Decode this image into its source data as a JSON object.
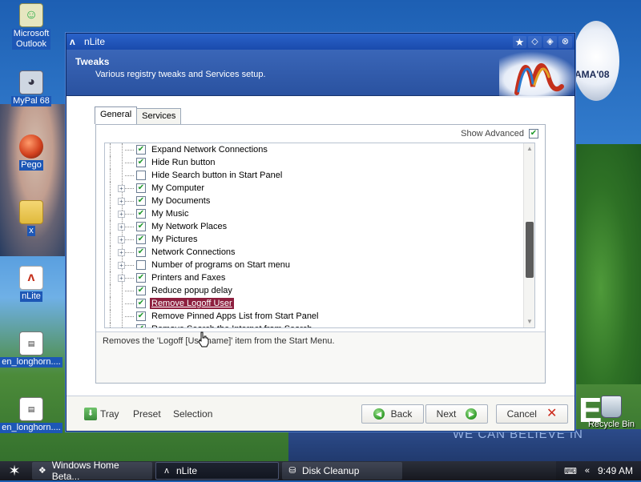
{
  "desktop": {
    "icons": [
      {
        "label_lines": [
          "Microsoft",
          "Outlook"
        ]
      },
      {
        "label_lines": [
          "MyPal 68"
        ]
      },
      {
        "label_lines": [
          "Pego"
        ]
      },
      {
        "label_lines": [
          "x"
        ]
      },
      {
        "label_lines": [
          "nLite"
        ]
      },
      {
        "label_lines": [
          "en_longhorn...."
        ]
      },
      {
        "label_lines": [
          "en_longhorn...."
        ]
      }
    ],
    "recycle_bin_label": "Recycle Bin",
    "wallpaper_text": {
      "campaign": "AMA'08",
      "slogan": "WE CAN BELIEVE IN",
      "letter": "E"
    }
  },
  "window": {
    "title": "nLite",
    "title_buttons": [
      "star",
      "restore",
      "minimize",
      "close"
    ],
    "header": {
      "title": "Tweaks",
      "subtitle": "Various registry tweaks and Services setup."
    },
    "tabs": [
      {
        "label": "General",
        "active": true
      },
      {
        "label": "Services",
        "active": false
      }
    ],
    "show_advanced": {
      "label": "Show Advanced",
      "checked": true
    },
    "tree_items": [
      {
        "label": "Expand Network Connections",
        "checked": true,
        "expander": false,
        "selected": false
      },
      {
        "label": "Hide Run button",
        "checked": true,
        "expander": false,
        "selected": false
      },
      {
        "label": "Hide Search button in Start Panel",
        "checked": false,
        "expander": false,
        "selected": false
      },
      {
        "label": "My Computer",
        "checked": true,
        "expander": true,
        "selected": false
      },
      {
        "label": "My Documents",
        "checked": true,
        "expander": true,
        "selected": false
      },
      {
        "label": "My Music",
        "checked": true,
        "expander": true,
        "selected": false
      },
      {
        "label": "My Network Places",
        "checked": true,
        "expander": true,
        "selected": false
      },
      {
        "label": "My Pictures",
        "checked": true,
        "expander": true,
        "selected": false
      },
      {
        "label": "Network Connections",
        "checked": true,
        "expander": true,
        "selected": false
      },
      {
        "label": "Number of programs on Start menu",
        "checked": false,
        "expander": true,
        "selected": false
      },
      {
        "label": "Printers and Faxes",
        "checked": true,
        "expander": true,
        "selected": false
      },
      {
        "label": "Reduce popup delay",
        "checked": true,
        "expander": false,
        "selected": false
      },
      {
        "label": "Remove Logoff User",
        "checked": true,
        "expander": false,
        "selected": true
      },
      {
        "label": "Remove Pinned Apps List from Start Panel",
        "checked": true,
        "expander": false,
        "selected": false
      },
      {
        "label": "Remove Search the Internet from Search",
        "checked": true,
        "expander": false,
        "selected": false
      }
    ],
    "description": "Removes the 'Logoff [Username]' item from the Start Menu.",
    "footer": {
      "tray": "Tray",
      "preset": "Preset",
      "selection": "Selection",
      "back": "Back",
      "next": "Next",
      "cancel": "Cancel"
    }
  },
  "taskbar": {
    "tasks": [
      {
        "label": "Windows Home Beta...",
        "active": false
      },
      {
        "label": "nLite",
        "active": true
      },
      {
        "label": "Disk Cleanup",
        "active": false
      }
    ],
    "tray_keyboard": "«",
    "clock": "9:49 AM"
  },
  "colors": {
    "title_bar": "#1a4bad",
    "header": "#2a52a0",
    "selection": "#8d1f3e",
    "check": "#1f9a2a",
    "cancel_x": "#cc2a1c"
  }
}
